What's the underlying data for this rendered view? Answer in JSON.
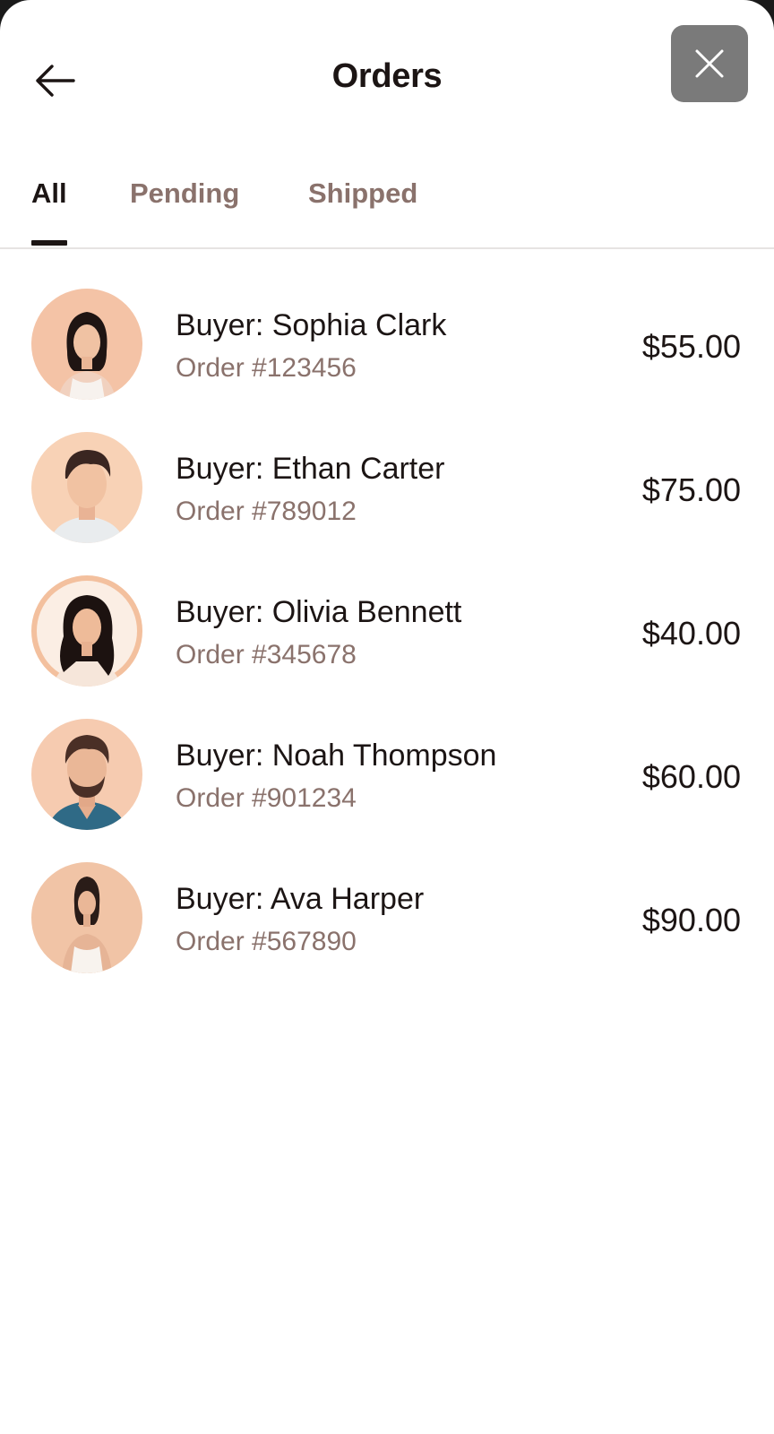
{
  "header": {
    "title": "Orders",
    "back_icon": "arrow-left-icon",
    "close_icon": "close-icon"
  },
  "tabs": [
    {
      "label": "All",
      "active": true
    },
    {
      "label": "Pending",
      "active": false
    },
    {
      "label": "Shipped",
      "active": false
    }
  ],
  "orders": [
    {
      "buyer": "Buyer: Sophia Clark",
      "order": "Order #123456",
      "price": "$55.00",
      "avatar_icon": "woman-avatar"
    },
    {
      "buyer": "Buyer: Ethan Carter",
      "order": "Order #789012",
      "price": "$75.00",
      "avatar_icon": "man-avatar"
    },
    {
      "buyer": "Buyer: Olivia Bennett",
      "order": "Order #345678",
      "price": "$40.00",
      "avatar_icon": "woman-avatar"
    },
    {
      "buyer": "Buyer: Noah Thompson",
      "order": "Order #901234",
      "price": "$60.00",
      "avatar_icon": "man-avatar"
    },
    {
      "buyer": "Buyer: Ava Harper",
      "order": "Order #567890",
      "price": "$90.00",
      "avatar_icon": "woman-avatar"
    }
  ],
  "colors": {
    "text_primary": "#1c1514",
    "text_muted": "#8a726c",
    "close_button_bg": "#7a7a7a",
    "avatar_bg": "#f6c9a8"
  }
}
